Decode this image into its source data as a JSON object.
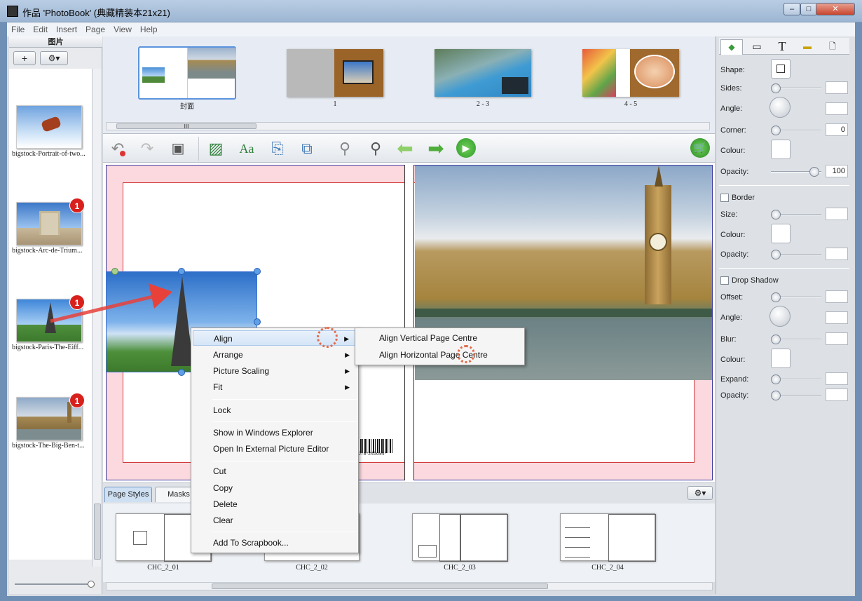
{
  "window": {
    "title": "作品 'PhotoBook' (典藏精装本21x21)",
    "controls": [
      "–",
      "□",
      "✕"
    ]
  },
  "menu": [
    "File",
    "Edit",
    "Insert",
    "Page",
    "View",
    "Help"
  ],
  "left_panel": {
    "title": "图片",
    "add_label": "+",
    "settings_label": "⚙▾",
    "photos": [
      {
        "label": "bigstock-Portrait-of-two...",
        "badge": ""
      },
      {
        "label": "bigstock-Arc-de-Trium...",
        "badge": "1"
      },
      {
        "label": "bigstock-Paris-The-Eiff...",
        "badge": "1"
      },
      {
        "label": "bigstock-The-Big-Ben-t...",
        "badge": "1"
      }
    ]
  },
  "pages": [
    {
      "label": "封面"
    },
    {
      "label": "1"
    },
    {
      "label": "2 - 3"
    },
    {
      "label": "4 - 5"
    }
  ],
  "strip_scroll_label": "III",
  "toolbar": {
    "icons": [
      "undo-icon",
      "redo-icon",
      "save-icon",
      "add-picture-icon",
      "add-text-icon",
      "insert-page-icon",
      "duplicate-page-icon",
      "zoom-out-icon",
      "zoom-in-icon",
      "previous-page-icon",
      "next-page-icon",
      "play-icon",
      "cart-icon"
    ]
  },
  "canvas": {
    "barcode_text": "3078*245094*"
  },
  "bottom_tabs": [
    "Page Styles",
    "Masks"
  ],
  "page_styles": [
    {
      "label": "CHC_2_01"
    },
    {
      "label": "CHC_2_02"
    },
    {
      "label": "CHC_2_03"
    },
    {
      "label": "CHC_2_04"
    }
  ],
  "right_panel": {
    "tabs": [
      "shape-tool-icon",
      "frame-tool-icon",
      "text-tool-icon",
      "ruler-tool-icon",
      "page-tool-icon"
    ],
    "shape_label": "Shape:",
    "sides_label": "Sides:",
    "angle_label": "Angle:",
    "corner_label": "Corner:",
    "corner_value": "0",
    "colour_label": "Colour:",
    "opacity_label": "Opacity:",
    "opacity_value": "100",
    "border_label": "Border",
    "size_label": "Size:",
    "border_colour_label": "Colour:",
    "border_opacity_label": "Opacity:",
    "shadow_label": "Drop Shadow",
    "offset_label": "Offset:",
    "shadow_angle_label": "Angle:",
    "blur_label": "Blur:",
    "shadow_colour_label": "Colour:",
    "expand_label": "Expand:",
    "shadow_opacity_label": "Opacity:"
  },
  "context_menu": {
    "items": [
      {
        "label": "Align",
        "submenu": true
      },
      {
        "label": "Arrange",
        "submenu": true
      },
      {
        "label": "Picture Scaling",
        "submenu": true
      },
      {
        "label": "Fit",
        "submenu": true
      },
      {
        "label": "Lock"
      },
      {
        "label": "Show in Windows Explorer"
      },
      {
        "label": "Open In External Picture Editor"
      },
      {
        "label": "Cut"
      },
      {
        "label": "Copy"
      },
      {
        "label": "Delete"
      },
      {
        "label": "Clear"
      },
      {
        "label": "Add To Scrapbook..."
      }
    ],
    "submenu": [
      {
        "label": "Align Vertical Page Centre"
      },
      {
        "label": "Align Horizontal Page Centre"
      }
    ]
  }
}
